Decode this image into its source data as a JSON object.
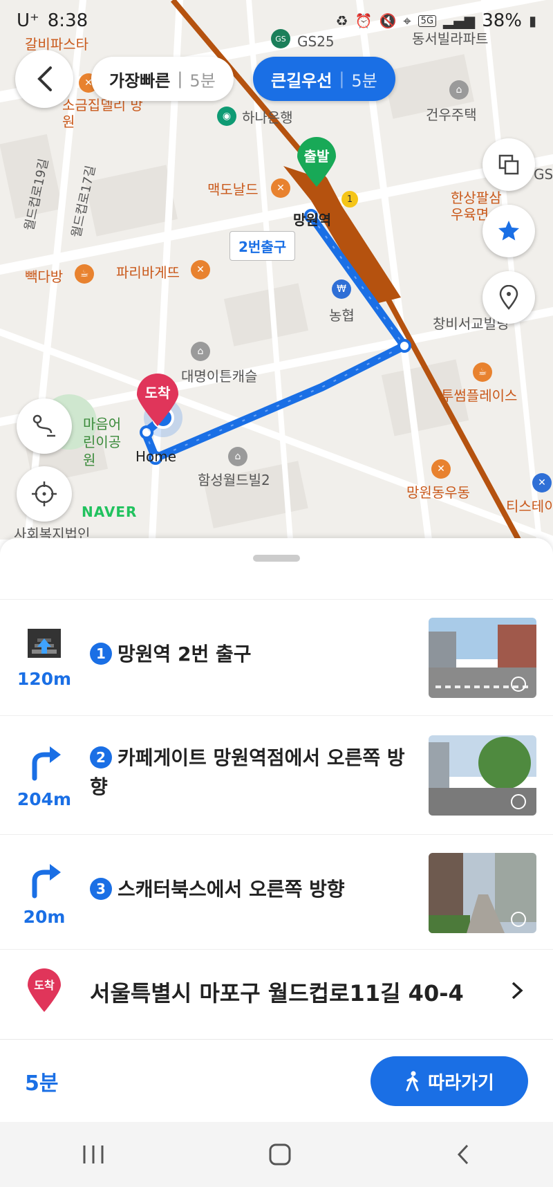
{
  "status_bar": {
    "carrier": "U⁺",
    "time": "8:38",
    "network": "5G",
    "battery": "38%"
  },
  "route_options": [
    {
      "label": "가장빠른",
      "time": "5분"
    },
    {
      "label": "큰길우선",
      "time": "5분"
    }
  ],
  "map": {
    "start_label": "출발",
    "end_label": "도착",
    "exit_label": "2번출구",
    "home_label": "Home",
    "watermark": "NAVER",
    "pois": [
      "갈비파스타",
      "GS25",
      "하나은행",
      "소금집델리 망원",
      "맥도날드",
      "망원역",
      "한상팔삼 우육면",
      "빽다방",
      "파리바게뜨",
      "농협",
      "창비서교빌딩",
      "대명이튼캐슬",
      "투썸플레이스",
      "함성월드빌2",
      "망원동우동",
      "티스테이",
      "사회복지법인",
      "동서빌라파트",
      "건우주택",
      "월드컵로19길",
      "월드컵로17길",
      "마음어린이공원",
      "GS"
    ]
  },
  "steps": [
    {
      "num": "1",
      "text": "망원역 2번 출구",
      "distance": "120m"
    },
    {
      "num": "2",
      "text": "카페게이트 망원역점에서 오른쪽 방향",
      "distance": "204m"
    },
    {
      "num": "3",
      "text": "스캐터북스에서 오른쪽 방향",
      "distance": "20m"
    }
  ],
  "destination": {
    "badge": "도착",
    "address": "서울특별시 마포구 월드컵로11길 40-4"
  },
  "bottom": {
    "total_time": "5분",
    "follow_label": "따라가기"
  },
  "colors": {
    "accent": "#1a6fe5",
    "subway_line": "#b5520f",
    "start_marker": "#18a957",
    "end_marker": "#e0355a"
  }
}
